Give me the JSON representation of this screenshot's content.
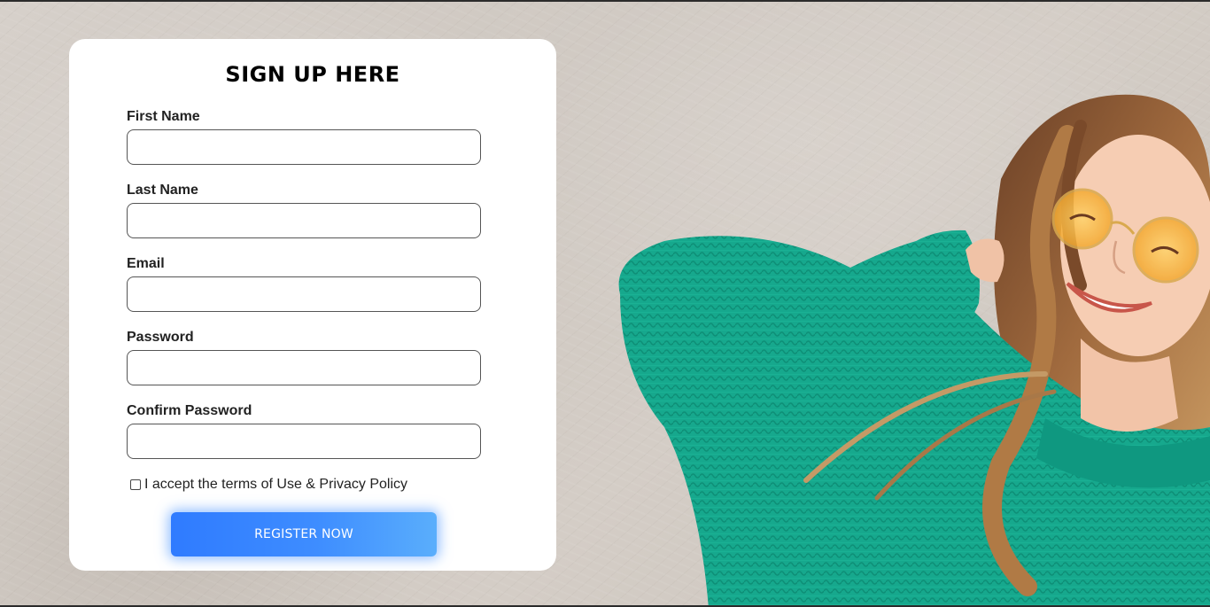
{
  "form": {
    "title": "SIGN UP HERE",
    "fields": [
      {
        "label": "First Name",
        "value": "",
        "placeholder": ""
      },
      {
        "label": "Last Name",
        "value": "",
        "placeholder": ""
      },
      {
        "label": "Email",
        "value": "",
        "placeholder": ""
      },
      {
        "label": "Password",
        "value": "",
        "placeholder": ""
      },
      {
        "label": "Confirm Password",
        "value": "",
        "placeholder": ""
      }
    ],
    "terms_label": "I accept the terms of Use & Privacy Policy",
    "terms_checked": false,
    "submit_label": "REGISTER NOW"
  },
  "colors": {
    "button_start": "#2f7bff",
    "button_end": "#5aaefc",
    "sweater": "#13a98e",
    "wall": "#d3ccc5",
    "card": "#ffffff"
  },
  "hero": {
    "description_icon": "smiling-woman-photo"
  }
}
